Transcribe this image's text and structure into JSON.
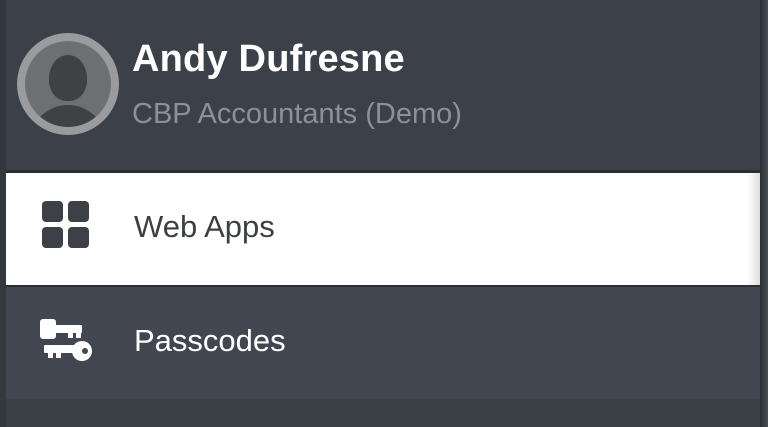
{
  "profile": {
    "name": "Andy Dufresne",
    "organization": "CBP Accountants (Demo)",
    "avatar_icon": "user-avatar-placeholder"
  },
  "menu": {
    "items": [
      {
        "label": "Web Apps",
        "icon": "grid-icon",
        "active": true
      },
      {
        "label": "Passcodes",
        "icon": "keys-icon",
        "active": false
      }
    ]
  },
  "colors": {
    "drawer_bg": "#3b3f46",
    "active_bg": "#ffffff",
    "active_text": "#3c3f44",
    "inactive_text": "#ffffff",
    "org_text": "#8d9096"
  }
}
